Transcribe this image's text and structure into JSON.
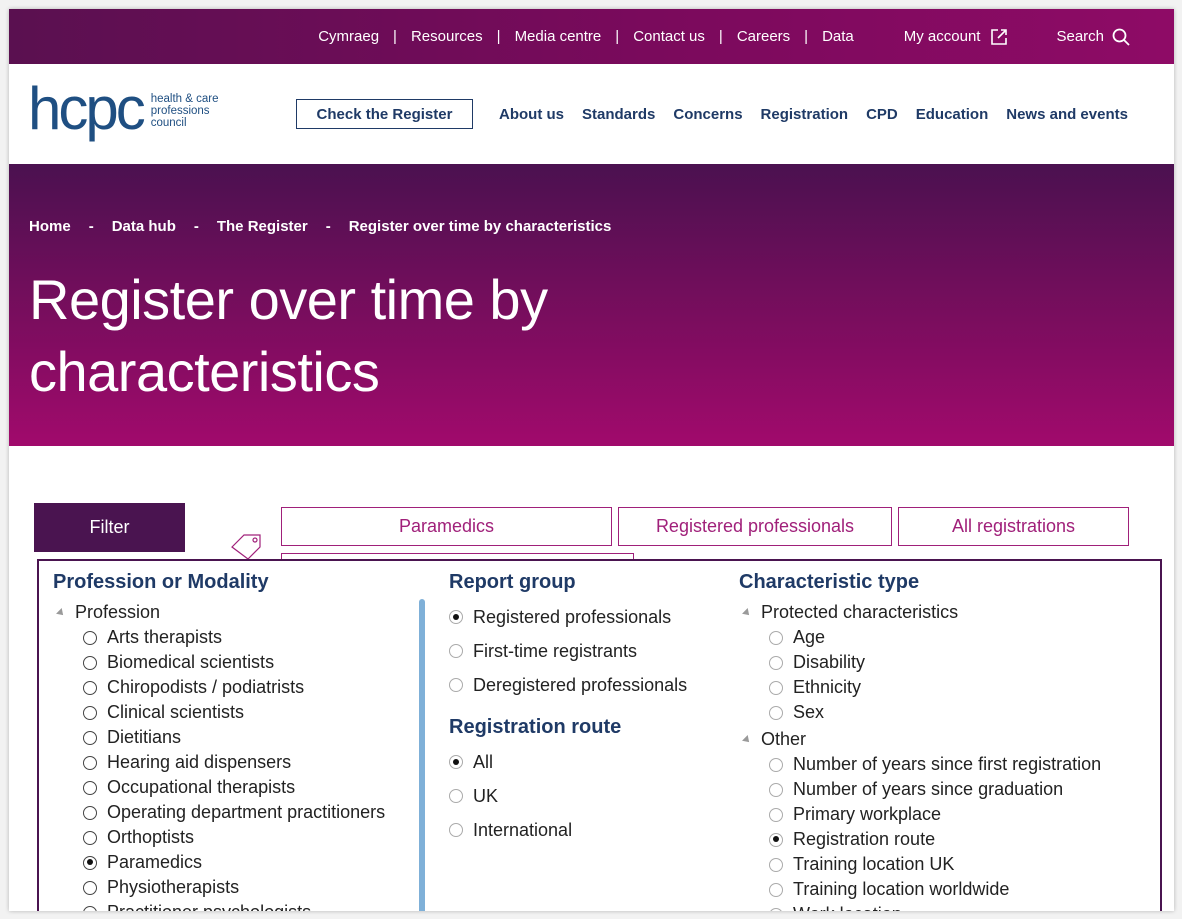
{
  "utility": {
    "links": [
      "Cymraeg",
      "Resources",
      "Media centre",
      "Contact us",
      "Careers",
      "Data"
    ],
    "separator": "|",
    "account": "My account",
    "search": "Search"
  },
  "logo": {
    "mark": "hcpc",
    "line1": "health & care",
    "line2": "professions",
    "line3": "council"
  },
  "header": {
    "check_register": "Check the Register",
    "nav": [
      "About us",
      "Standards",
      "Concerns",
      "Registration",
      "CPD",
      "Education",
      "News and events"
    ]
  },
  "breadcrumb": [
    "Home",
    "Data hub",
    "The Register",
    "Register over time by characteristics"
  ],
  "breadcrumb_sep": "-",
  "page_title": "Register over time by characteristics",
  "filter": {
    "tab_label": "Filter",
    "chips": [
      "Paramedics",
      "Registered professionals",
      "All registrations"
    ]
  },
  "profession": {
    "title": "Profession or Modality",
    "group": "Profession",
    "options": [
      {
        "label": "Arts therapists",
        "selected": false
      },
      {
        "label": "Biomedical scientists",
        "selected": false
      },
      {
        "label": "Chiropodists / podiatrists",
        "selected": false
      },
      {
        "label": "Clinical scientists",
        "selected": false
      },
      {
        "label": "Dietitians",
        "selected": false
      },
      {
        "label": "Hearing aid dispensers",
        "selected": false
      },
      {
        "label": "Occupational therapists",
        "selected": false
      },
      {
        "label": "Operating department practitioners",
        "selected": false
      },
      {
        "label": "Orthoptists",
        "selected": false
      },
      {
        "label": "Paramedics",
        "selected": true
      },
      {
        "label": "Physiotherapists",
        "selected": false
      },
      {
        "label": "Practitioner psychologists",
        "selected": false
      }
    ]
  },
  "report_group": {
    "title": "Report group",
    "options": [
      {
        "label": "Registered professionals",
        "selected": true
      },
      {
        "label": "First-time registrants",
        "selected": false
      },
      {
        "label": "Deregistered professionals",
        "selected": false
      }
    ]
  },
  "registration_route": {
    "title": "Registration route",
    "options": [
      {
        "label": "All",
        "selected": true
      },
      {
        "label": "UK",
        "selected": false
      },
      {
        "label": "International",
        "selected": false
      }
    ]
  },
  "characteristic": {
    "title": "Characteristic type",
    "group1": "Protected characteristics",
    "group1_options": [
      {
        "label": "Age",
        "selected": false
      },
      {
        "label": "Disability",
        "selected": false
      },
      {
        "label": "Ethnicity",
        "selected": false
      },
      {
        "label": "Sex",
        "selected": false
      }
    ],
    "group2": "Other",
    "group2_options": [
      {
        "label": "Number of years since first registration",
        "selected": false
      },
      {
        "label": "Number of years since graduation",
        "selected": false
      },
      {
        "label": "Primary workplace",
        "selected": false
      },
      {
        "label": "Registration route",
        "selected": true
      },
      {
        "label": "Training location UK",
        "selected": false
      },
      {
        "label": "Training location worldwide",
        "selected": false
      },
      {
        "label": "Work location",
        "selected": false
      }
    ]
  },
  "colors": {
    "brand_purple": "#4a1450",
    "brand_magenta": "#a0207a",
    "navy": "#1f3a66",
    "scrollbar": "#7fb0d8"
  }
}
